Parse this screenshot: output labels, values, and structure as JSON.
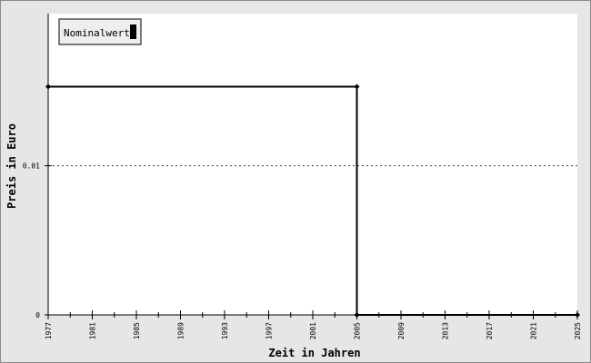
{
  "chart_data": {
    "type": "line",
    "title": "",
    "xlabel": "Zeit in Jahren",
    "ylabel": "Preis in Euro",
    "xlim": [
      1977,
      2025
    ],
    "ylim": [
      0,
      0.0202
    ],
    "x_ticks": [
      1977,
      1981,
      1985,
      1989,
      1993,
      1997,
      2001,
      2005,
      2009,
      2013,
      2017,
      2021,
      2025
    ],
    "x_tick_labels": [
      "1977",
      "1981",
      "1985",
      "1989",
      "1993",
      "1997",
      "2001",
      "2005",
      "2009",
      "2013",
      "2017",
      "2021",
      "2025"
    ],
    "y_ticks": [
      0,
      0.01
    ],
    "y_tick_labels": [
      "0",
      "0.01"
    ],
    "reference_line": {
      "y": 0.01,
      "style": "dotted",
      "color": "#3333aa"
    },
    "legend": {
      "position": "top-left",
      "entries": [
        "Nominalwert"
      ]
    },
    "series": [
      {
        "name": "Nominalwert",
        "color": "#000000",
        "style": "step",
        "points": [
          {
            "x": 1977,
            "y": 0.0153
          },
          {
            "x": 2005,
            "y": 0.0153
          },
          {
            "x": 2005,
            "y": 0
          },
          {
            "x": 2025,
            "y": 0
          }
        ]
      }
    ]
  }
}
